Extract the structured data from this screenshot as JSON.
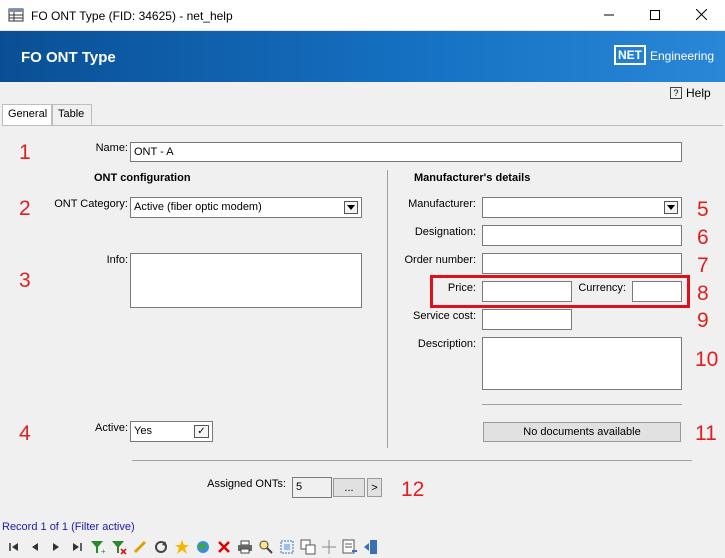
{
  "window": {
    "title": "FO ONT Type (FID: 34625) - net_help"
  },
  "banner": {
    "title": "FO ONT Type",
    "logo_box": "NET",
    "logo_text": "Engineering"
  },
  "help": {
    "label": "Help",
    "icon_glyph": "?"
  },
  "tabs": [
    {
      "label": "General",
      "active": true
    },
    {
      "label": "Table",
      "active": false
    }
  ],
  "markers": [
    "1",
    "2",
    "3",
    "4",
    "5",
    "6",
    "7",
    "8",
    "9",
    "10",
    "11",
    "12"
  ],
  "form": {
    "name_label": "Name:",
    "name_value": "ONT - A",
    "ont_config_header": "ONT configuration",
    "ont_category_label": "ONT Category:",
    "ont_category_value": "Active (fiber optic modem)",
    "info_label": "Info:",
    "info_value": "",
    "active_label": "Active:",
    "active_value": "Yes",
    "active_check": "✓",
    "manufacturer_header": "Manufacturer's details",
    "manufacturer_label": "Manufacturer:",
    "manufacturer_value": "",
    "designation_label": "Designation:",
    "designation_value": "",
    "order_number_label": "Order number:",
    "order_number_value": "",
    "price_label": "Price:",
    "price_value": "",
    "currency_label": "Currency:",
    "currency_value": "",
    "service_cost_label": "Service cost:",
    "service_cost_value": "",
    "description_label": "Description:",
    "description_value": "",
    "documents_button": "No documents available",
    "assigned_onts_label": "Assigned ONTs:",
    "assigned_onts_value": "5",
    "browse_button": "...",
    "goto_button": ">"
  },
  "status": {
    "record_text": "Record 1 of 1 (Filter active)"
  },
  "colors": {
    "banner_start": "#0a4f95",
    "banner_end": "#2a86d6",
    "marker_red": "#e02020",
    "status_blue": "#1a1ab0"
  },
  "toolbar_icons": [
    "first-record-icon",
    "prev-record-icon",
    "next-record-icon",
    "last-record-icon",
    "filter-add-icon",
    "filter-remove-icon",
    "edit-pencil-icon",
    "refresh-icon",
    "new-star-icon",
    "globe-icon",
    "delete-icon",
    "print-icon",
    "zoom-icon",
    "select-icon",
    "copy-icon",
    "move-icon",
    "report-icon",
    "exit-icon"
  ]
}
